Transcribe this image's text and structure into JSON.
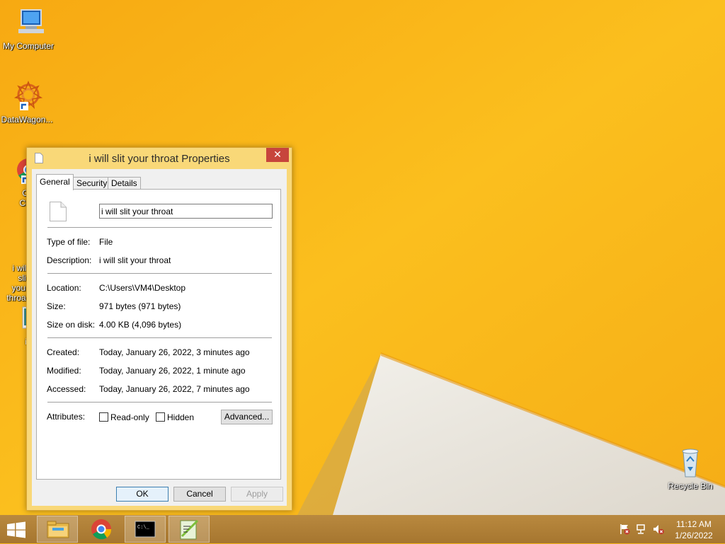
{
  "desktop": {
    "icons": [
      {
        "label": "My Computer",
        "icon": "my-computer-icon"
      },
      {
        "label": "DataWagon...",
        "icon": "datawagon-icon"
      },
      {
        "label": "Google Chrome",
        "icon": "chrome-icon"
      },
      {
        "label": "i will slit your throat",
        "icon": "file-icon"
      },
      {
        "label": "iw",
        "icon": "image-file-icon"
      },
      {
        "label": "Recycle Bin",
        "icon": "recycle-bin-icon"
      }
    ]
  },
  "dialog": {
    "title": "i will slit your throat Properties",
    "close_glyph": "✕",
    "tabs": [
      {
        "label": "General",
        "active": true
      },
      {
        "label": "Security",
        "active": false
      },
      {
        "label": "Details",
        "active": false
      }
    ],
    "general": {
      "file_name": "i will slit your throat",
      "type_label": "Type of file:",
      "type_value": "File",
      "description_label": "Description:",
      "description_value": "i will slit your throat",
      "location_label": "Location:",
      "location_value": "C:\\Users\\VM4\\Desktop",
      "size_label": "Size:",
      "size_value": "971 bytes (971 bytes)",
      "size_on_disk_label": "Size on disk:",
      "size_on_disk_value": "4.00 KB (4,096 bytes)",
      "created_label": "Created:",
      "created_value": "Today, January 26, 2022, 3 minutes ago",
      "modified_label": "Modified:",
      "modified_value": "Today, January 26, 2022, 1 minute ago",
      "accessed_label": "Accessed:",
      "accessed_value": "Today, January 26, 2022, 7 minutes ago",
      "attributes_label": "Attributes:",
      "readonly_label": "Read-only",
      "readonly_checked": false,
      "hidden_label": "Hidden",
      "hidden_checked": false,
      "advanced_label": "Advanced..."
    },
    "buttons": {
      "ok": "OK",
      "cancel": "Cancel",
      "apply": "Apply"
    }
  },
  "taskbar": {
    "items": [
      {
        "icon": "file-explorer-icon",
        "pinned": true
      },
      {
        "icon": "chrome-icon",
        "pinned": false
      },
      {
        "icon": "command-prompt-icon",
        "pinned": true
      },
      {
        "icon": "notepad-plus-plus-icon",
        "pinned": true
      }
    ],
    "tray": [
      "action-center-flag-icon",
      "network-icon",
      "volume-muted-icon"
    ],
    "time": "11:12 AM",
    "date": "1/26/2022"
  },
  "colors": {
    "wallpaper": "#f5b41a",
    "dialog_frame": "#f9d878",
    "close_button": "#c7453c",
    "taskbar": "#b07e3b"
  }
}
